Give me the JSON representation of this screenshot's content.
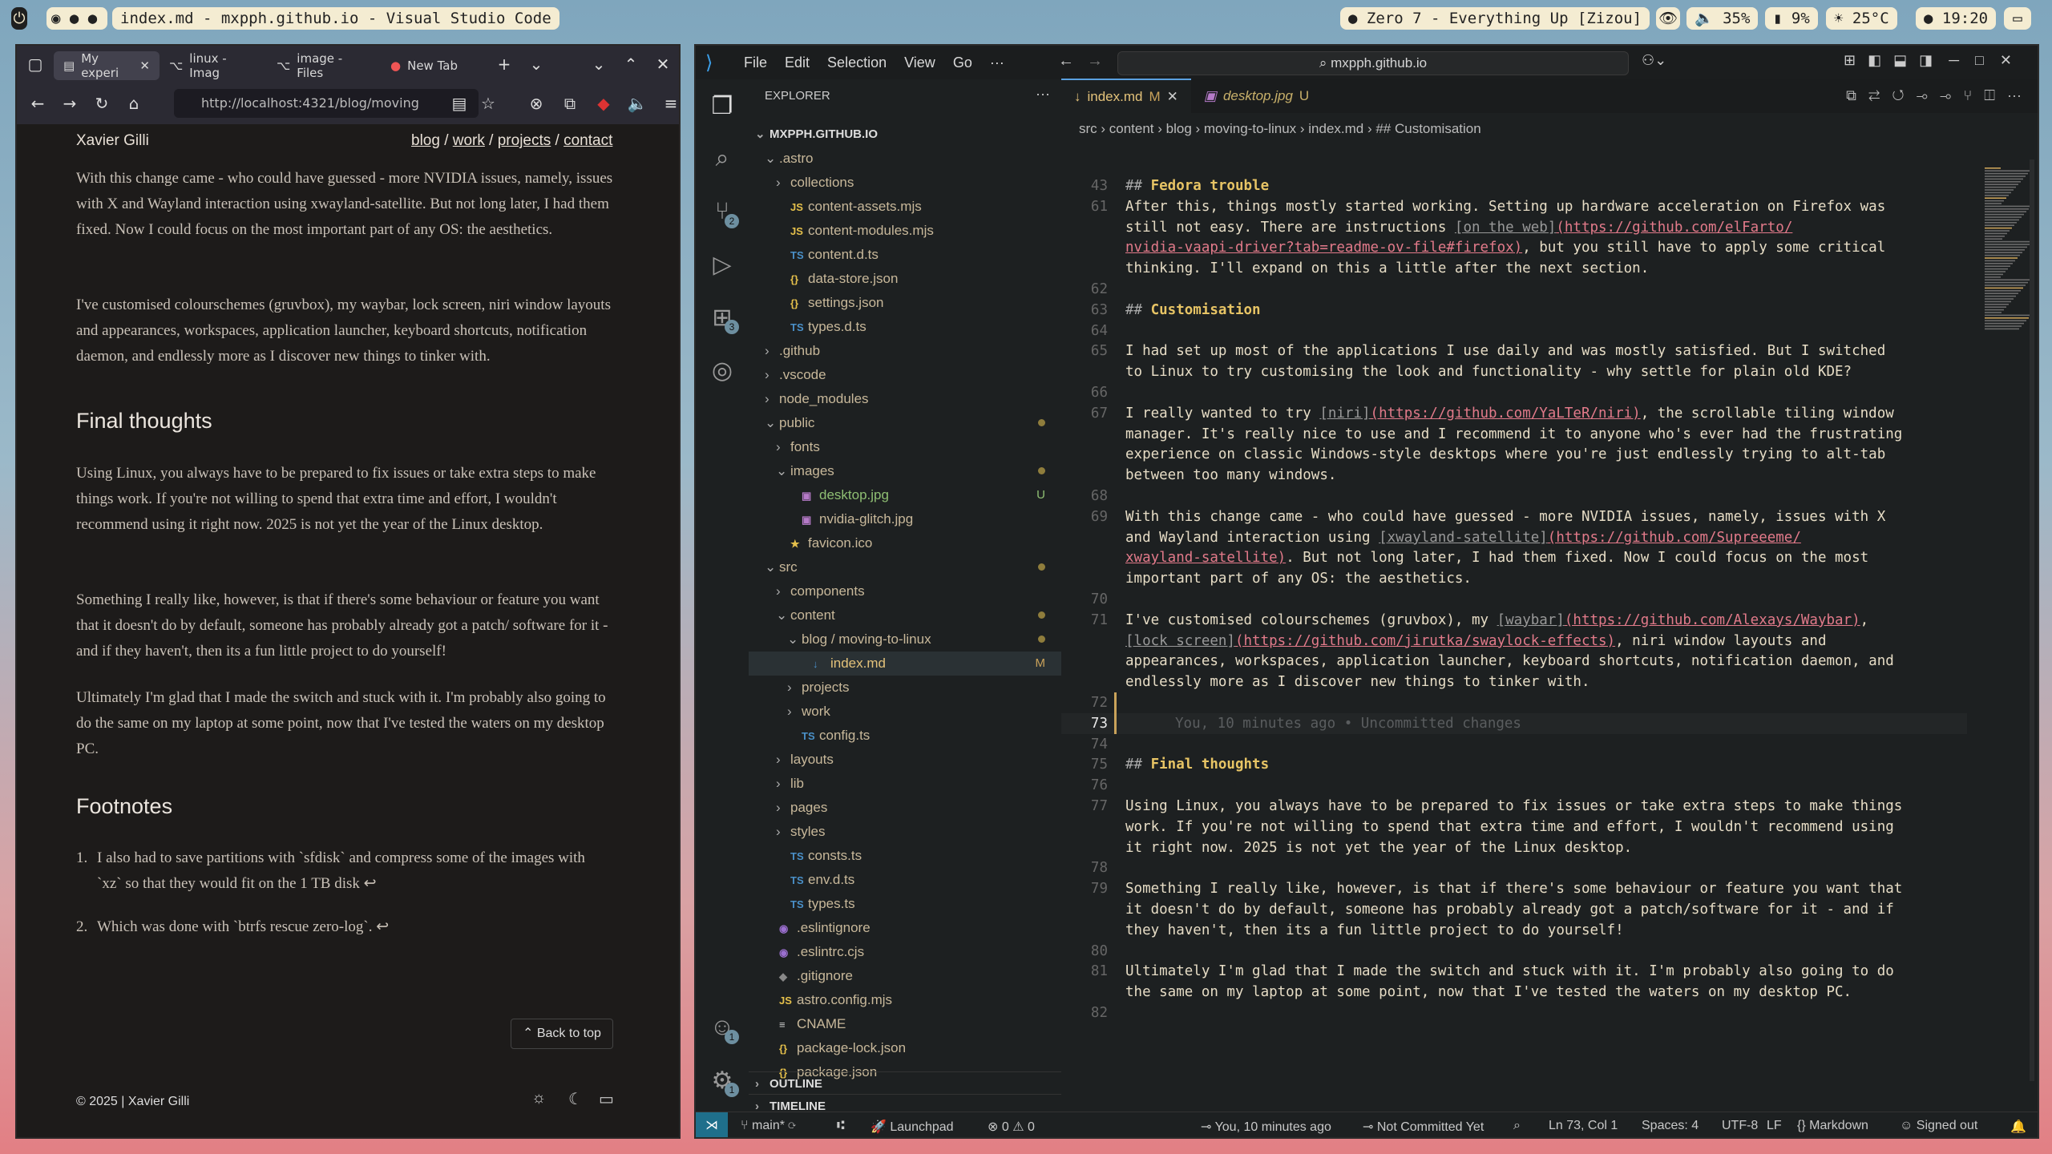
{
  "topbar": {
    "window_title": "index.md - mxpph.github.io - Visual Studio Code",
    "music": "Zero 7 - Everything Up [Zizou]",
    "volume": "35%",
    "battery": "9%",
    "weather": "25°C",
    "clock": "19:20"
  },
  "firefox": {
    "tabs": [
      "My experi",
      "linux - Imag",
      "image - Files",
      "New Tab"
    ],
    "url": "http://localhost:4321/blog/moving",
    "site_name": "Xavier Gilli",
    "nav": {
      "blog": "blog",
      "work": "work",
      "projects": "projects",
      "contact": "contact",
      "sep": "/"
    },
    "paragraphs": [
      "With this change came - who could have guessed - more NVIDIA issues, namely, issues with X and Wayland interaction using xwayland-satellite. But not long later, I had them fixed. Now I could focus on the most important part of any OS: the aesthetics.",
      "I've customised colourschemes (gruvbox), my waybar, lock screen, niri window layouts and appearances, workspaces, application launcher, keyboard shortcuts, notification daemon, and endlessly more as I discover new things to tinker with."
    ],
    "final_heading": "Final thoughts",
    "final_paragraphs": [
      "Using Linux, you always have to be prepared to fix issues or take extra steps to make things work. If you're not willing to spend that extra time and effort, I wouldn't recommend using it right now. 2025 is not yet the year of the Linux desktop.",
      "Something I really like, however, is that if there's some behaviour or feature you want that it doesn't do by default, someone has probably already got a patch/ software for it - and if they haven't, then its a fun little project to do yourself!",
      "Ultimately I'm glad that I made the switch and stuck with it. I'm probably also going to do the same on my laptop at some point, now that I've tested the waters on my desktop PC."
    ],
    "footnotes_heading": "Footnotes",
    "footnotes": [
      "I also had to save partitions with `sfdisk` and compress some of the images with `xz` so that they would fit on the 1 TB disk ↩",
      "Which was done with `btrfs rescue zero-log`. ↩"
    ],
    "back_to_top": "Back to top",
    "copyright": "© 2025 | Xavier Gilli"
  },
  "vscode": {
    "menus": [
      "File",
      "Edit",
      "Selection",
      "View",
      "Go",
      "···"
    ],
    "command_center": "mxpph.github.io",
    "explorer_title": "EXPLORER",
    "root": "MXPPH.GITHUB.IO",
    "tree": [
      {
        "d": 0,
        "chev": "⌄",
        "icon": "",
        "name": ".astro",
        "st": ""
      },
      {
        "d": 1,
        "chev": "›",
        "icon": "",
        "name": "collections",
        "st": ""
      },
      {
        "d": 1,
        "chev": "",
        "icon": "JS",
        "name": "content-assets.mjs",
        "st": ""
      },
      {
        "d": 1,
        "chev": "",
        "icon": "JS",
        "name": "content-modules.mjs",
        "st": ""
      },
      {
        "d": 1,
        "chev": "",
        "icon": "TS",
        "name": "content.d.ts",
        "st": ""
      },
      {
        "d": 1,
        "chev": "",
        "icon": "{}",
        "name": "data-store.json",
        "st": ""
      },
      {
        "d": 1,
        "chev": "",
        "icon": "{}",
        "name": "settings.json",
        "st": ""
      },
      {
        "d": 1,
        "chev": "",
        "icon": "TS",
        "name": "types.d.ts",
        "st": ""
      },
      {
        "d": 0,
        "chev": "›",
        "icon": "",
        "name": ".github",
        "st": ""
      },
      {
        "d": 0,
        "chev": "›",
        "icon": "",
        "name": ".vscode",
        "st": ""
      },
      {
        "d": 0,
        "chev": "›",
        "icon": "",
        "name": "node_modules",
        "st": ""
      },
      {
        "d": 0,
        "chev": "⌄",
        "icon": "",
        "name": "public",
        "st": "dot"
      },
      {
        "d": 1,
        "chev": "›",
        "icon": "",
        "name": "fonts",
        "st": ""
      },
      {
        "d": 1,
        "chev": "⌄",
        "icon": "",
        "name": "images",
        "st": "dot"
      },
      {
        "d": 2,
        "chev": "",
        "icon": "▣",
        "name": "desktop.jpg",
        "st": "U"
      },
      {
        "d": 2,
        "chev": "",
        "icon": "▣",
        "name": "nvidia-glitch.jpg",
        "st": ""
      },
      {
        "d": 1,
        "chev": "",
        "icon": "★",
        "name": "favicon.ico",
        "st": ""
      },
      {
        "d": 0,
        "chev": "⌄",
        "icon": "",
        "name": "src",
        "st": "dot"
      },
      {
        "d": 1,
        "chev": "›",
        "icon": "",
        "name": "components",
        "st": ""
      },
      {
        "d": 1,
        "chev": "⌄",
        "icon": "",
        "name": "content",
        "st": "dot"
      },
      {
        "d": 2,
        "chev": "⌄",
        "icon": "",
        "name": "blog / moving-to-linux",
        "st": "dot"
      },
      {
        "d": 3,
        "chev": "",
        "icon": "↓",
        "name": "index.md",
        "st": "M"
      },
      {
        "d": 2,
        "chev": "›",
        "icon": "",
        "name": "projects",
        "st": ""
      },
      {
        "d": 2,
        "chev": "›",
        "icon": "",
        "name": "work",
        "st": ""
      },
      {
        "d": 2,
        "chev": "",
        "icon": "TS",
        "name": "config.ts",
        "st": ""
      },
      {
        "d": 1,
        "chev": "›",
        "icon": "",
        "name": "layouts",
        "st": ""
      },
      {
        "d": 1,
        "chev": "›",
        "icon": "",
        "name": "lib",
        "st": ""
      },
      {
        "d": 1,
        "chev": "›",
        "icon": "",
        "name": "pages",
        "st": ""
      },
      {
        "d": 1,
        "chev": "›",
        "icon": "",
        "name": "styles",
        "st": ""
      },
      {
        "d": 1,
        "chev": "",
        "icon": "TS",
        "name": "consts.ts",
        "st": ""
      },
      {
        "d": 1,
        "chev": "",
        "icon": "TS",
        "name": "env.d.ts",
        "st": ""
      },
      {
        "d": 1,
        "chev": "",
        "icon": "TS",
        "name": "types.ts",
        "st": ""
      },
      {
        "d": 0,
        "chev": "",
        "icon": "◉",
        "name": ".eslintignore",
        "st": ""
      },
      {
        "d": 0,
        "chev": "",
        "icon": "◉",
        "name": ".eslintrc.cjs",
        "st": ""
      },
      {
        "d": 0,
        "chev": "",
        "icon": "◆",
        "name": ".gitignore",
        "st": ""
      },
      {
        "d": 0,
        "chev": "",
        "icon": "JS",
        "name": "astro.config.mjs",
        "st": ""
      },
      {
        "d": 0,
        "chev": "",
        "icon": "≡",
        "name": "CNAME",
        "st": ""
      },
      {
        "d": 0,
        "chev": "",
        "icon": "{}",
        "name": "package-lock.json",
        "st": ""
      },
      {
        "d": 0,
        "chev": "",
        "icon": "{}",
        "name": "package.json",
        "st": ""
      }
    ],
    "outline": "OUTLINE",
    "timeline": "TIMELINE",
    "tabs": [
      {
        "name": "index.md",
        "status": "M"
      },
      {
        "name": "desktop.jpg",
        "status": "U"
      }
    ],
    "breadcrumbs": "src › content › blog › moving-to-linux › index.md › ## Customisation",
    "status": {
      "branch": "main*",
      "launchpad": "Launchpad",
      "problems": "⊗ 0 ⚠ 0",
      "blame": "You, 10 minutes ago",
      "commit": "Not Committed Yet",
      "position": "Ln 73, Col 1",
      "spaces": "Spaces: 4",
      "encoding": "UTF-8",
      "eol": "LF",
      "language": "Markdown",
      "account": "Signed out"
    }
  }
}
